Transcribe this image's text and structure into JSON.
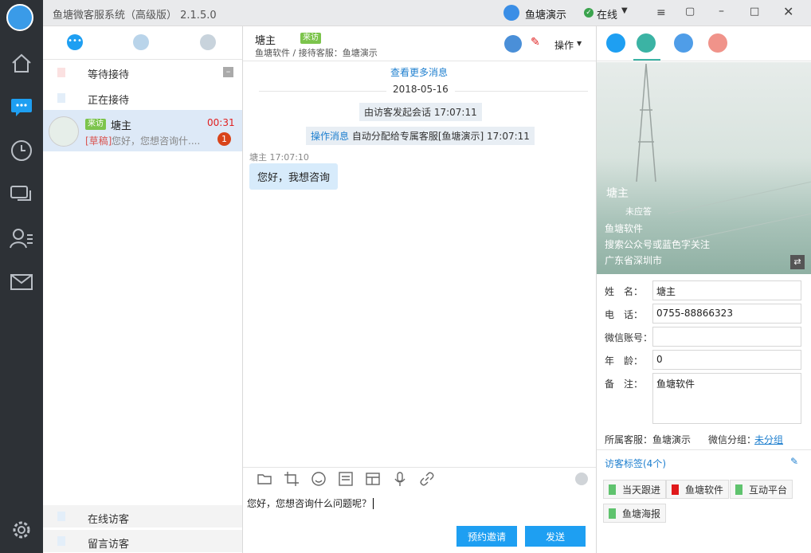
{
  "app": {
    "title": "鱼塘微客服系统（高级版） 2.1.5.0",
    "account": "鱼塘演示",
    "status": "在线"
  },
  "sidebar": {
    "items": [
      {
        "name": "home-icon"
      },
      {
        "name": "chat-icon"
      },
      {
        "name": "history-icon"
      },
      {
        "name": "comments-icon"
      },
      {
        "name": "contacts-icon"
      },
      {
        "name": "mail-icon"
      },
      {
        "name": "settings-icon"
      }
    ]
  },
  "convlist": {
    "sections": {
      "waiting": "等待接待",
      "serving": "正在接待",
      "online": "在线访客",
      "messages": "留言访客"
    },
    "active": {
      "badge": "来访",
      "name": "塘主",
      "time": "00:31",
      "draft": "[草稿]",
      "preview": "您好，您想咨询什....",
      "unread": "1"
    }
  },
  "chat": {
    "header": {
      "name": "塘主",
      "badge": "来访",
      "sub": "鱼塘软件 / 接待客服：鱼塘演示",
      "ops": "操作"
    },
    "more": "查看更多消息",
    "date": "2018-05-16",
    "sys1": "由访客发起会话 17:07:11",
    "sys2_label": "操作消息",
    "sys2": "自动分配给专属客服[鱼塘演示]  17:07:11",
    "msg_meta": "塘主 17:07:10",
    "msg": "您好，我想咨询",
    "input": "您好，您想咨询什么问题呢？",
    "btn_invite": "预约邀请",
    "btn_send": "发送"
  },
  "profile": {
    "name": "塘主",
    "status": "未应答",
    "company": "鱼塘软件",
    "desc": "搜索公众号或蓝色字关注",
    "location": "广东省深圳市",
    "fields": {
      "name_label": "姓　名：",
      "name": "塘主",
      "phone_label": "电　话：",
      "phone": "0755-88866323",
      "wechat_label": "微信账号：",
      "wechat": "",
      "age_label": "年　龄：",
      "age": "0",
      "note_label": "备　注：",
      "note": "鱼塘软件"
    },
    "owner": "所属客服：鱼塘演示",
    "group_label": "微信分组：",
    "group": "未分组",
    "tags_title": "访客标签(4个)",
    "tags": [
      {
        "label": "当天跟进",
        "color": "#5fc36e"
      },
      {
        "label": "鱼塘软件",
        "color": "#e0191b"
      },
      {
        "label": "互动平台",
        "color": "#5fc36e"
      },
      {
        "label": "鱼塘海报",
        "color": "#5fc36e"
      }
    ]
  },
  "colors": {
    "accent": "#1e9ff2",
    "sidebar": "#2d3136",
    "badge": "#7cc44c"
  }
}
